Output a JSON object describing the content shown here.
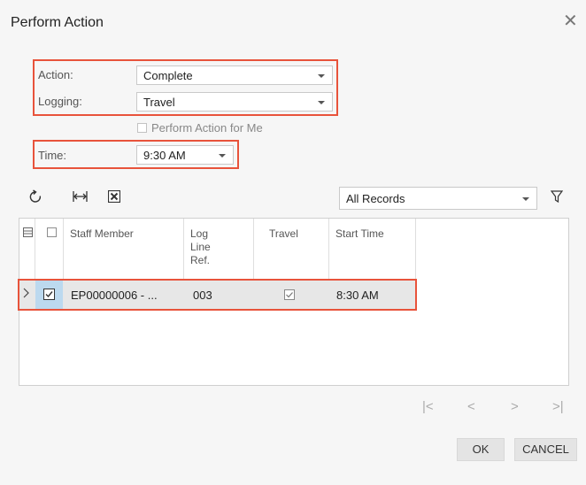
{
  "dialog": {
    "title": "Perform Action"
  },
  "form": {
    "action_label": "Action:",
    "action_value": "Complete",
    "logging_label": "Logging:",
    "logging_value": "Travel",
    "perform_for_me_label": "Perform Action for Me",
    "time_label": "Time:",
    "time_value": "9:30 AM"
  },
  "toolbar": {
    "filter_value": "All Records"
  },
  "grid": {
    "headers": {
      "staff": "Staff Member",
      "log_line_1": "Log",
      "log_line_2": "Line",
      "log_line_3": "Ref.",
      "travel": "Travel",
      "start": "Start Time"
    },
    "rows": [
      {
        "staff": "EP00000006 - ...",
        "log_line_ref": "003",
        "travel": true,
        "start_time": "8:30 AM",
        "selected": true
      }
    ]
  },
  "buttons": {
    "ok": "OK",
    "cancel": "CANCEL"
  },
  "colors": {
    "highlight": "#e8533b",
    "background": "#f6f6f6"
  },
  "icons": [
    "close-icon",
    "refresh-icon",
    "fit-columns-icon",
    "export-excel-icon",
    "filter-icon",
    "row-expand-icon"
  ]
}
